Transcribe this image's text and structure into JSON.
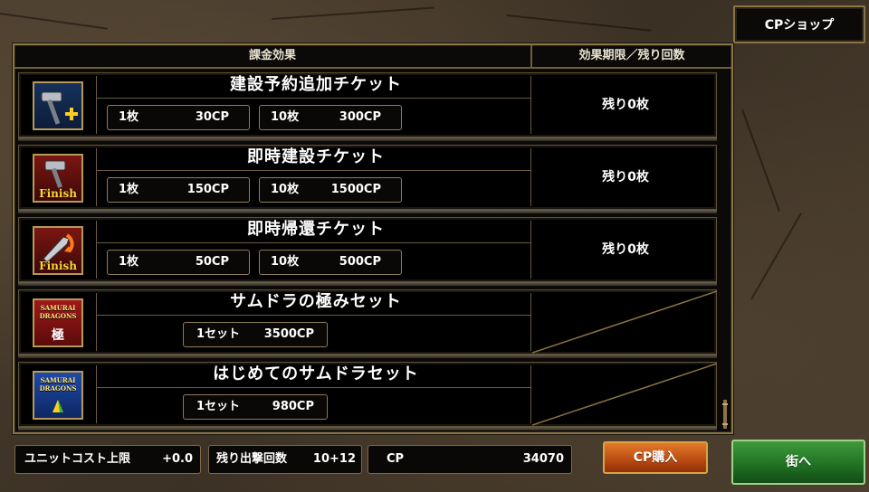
{
  "header": {
    "shop_title": "CPショップ",
    "col_effect": "課金効果",
    "col_limit": "効果期限／残り回数"
  },
  "items": [
    {
      "title": "建設予約追加チケット",
      "icon": "hammer-plus-icon",
      "options": [
        {
          "qty": "1枚",
          "price": "30CP"
        },
        {
          "qty": "10枚",
          "price": "300CP"
        }
      ],
      "remaining": "残り0枚"
    },
    {
      "title": "即時建設チケット",
      "icon": "hammer-finish-icon",
      "icon_label": "Finish",
      "options": [
        {
          "qty": "1枚",
          "price": "150CP"
        },
        {
          "qty": "10枚",
          "price": "1500CP"
        }
      ],
      "remaining": "残り0枚"
    },
    {
      "title": "即時帰還チケット",
      "icon": "sword-finish-icon",
      "icon_label": "Finish",
      "options": [
        {
          "qty": "1枚",
          "price": "50CP"
        },
        {
          "qty": "10枚",
          "price": "500CP"
        }
      ],
      "remaining": "残り0枚"
    },
    {
      "title": "サムドラの極みセット",
      "icon": "samurai-dragons-kiwami-icon",
      "icon_label": "極",
      "icon_logo": "SAMURAI DRAGONS",
      "options": [
        {
          "qty": "1セット",
          "price": "3500CP"
        }
      ]
    },
    {
      "title": "はじめてのサムドラセット",
      "icon": "samurai-dragons-beginner-icon",
      "icon_logo": "SAMURAI DRAGONS",
      "options": [
        {
          "qty": "1セット",
          "price": "980CP"
        }
      ]
    }
  ],
  "footer": {
    "unit_cost_label": "ユニットコスト上限",
    "unit_cost_value": "+0.0",
    "sorties_label": "残り出撃回数",
    "sorties_value": "10+12",
    "cp_label": "CP",
    "cp_value": "34070",
    "buy_cp": "CP購入",
    "to_town": "街へ"
  },
  "colors": {
    "frame": "#8a7445",
    "buy": "#d0601c",
    "town": "#2f8a30",
    "gold": "#ffd23a"
  }
}
